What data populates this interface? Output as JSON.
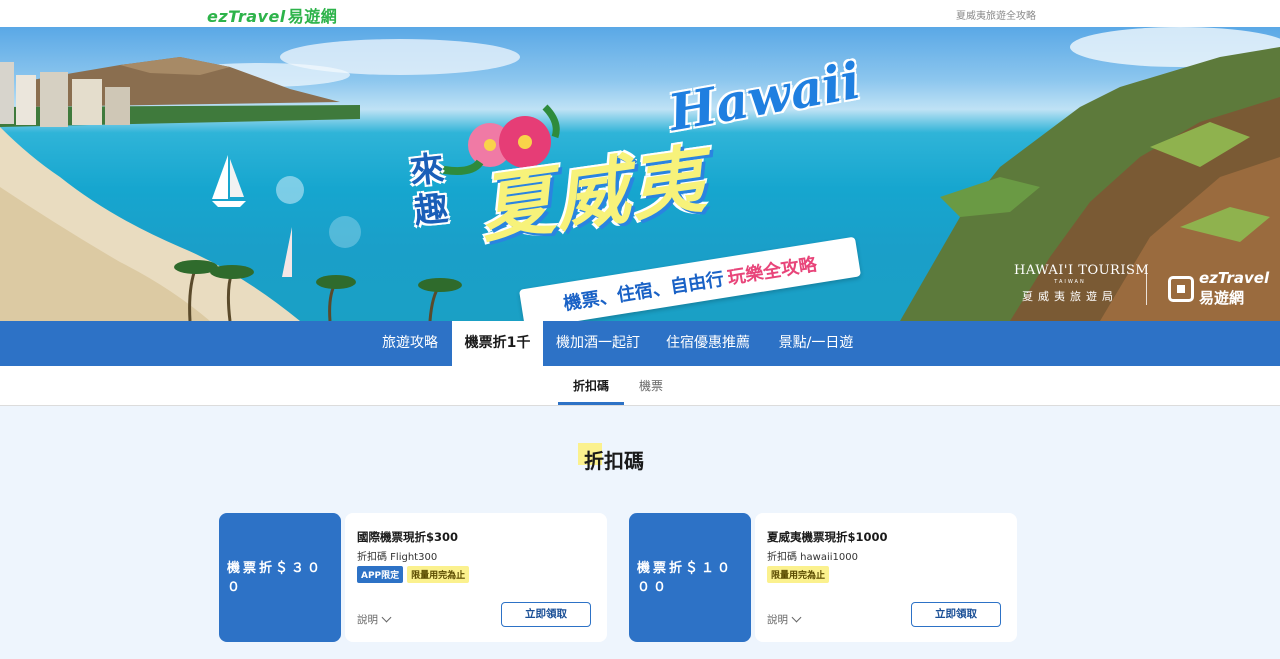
{
  "header": {
    "logo_en": "ezTravel",
    "logo_cn": "易遊網",
    "link": "夏威夷旅遊全攻略"
  },
  "banner": {
    "hawaii": "Hawaii",
    "come": "來趣",
    "main": "夏威夷",
    "ribbon_a": "機票、住宿、自由行",
    "ribbon_b": "玩樂全攻略",
    "tourism_en": "HAWAI'I TOURISM",
    "tourism_sub": "TAIWAN",
    "tourism_cn": "夏威夷旅遊局",
    "ez_en": "ezTravel",
    "ez_cn": "易遊網"
  },
  "main_nav": [
    {
      "label": "旅遊攻略"
    },
    {
      "label": "機票折1千"
    },
    {
      "label": "機加酒一起訂"
    },
    {
      "label": "住宿優惠推薦"
    },
    {
      "label": "景點/一日遊"
    }
  ],
  "sub_nav": [
    {
      "label": "折扣碼"
    },
    {
      "label": "機票"
    }
  ],
  "section": {
    "title": "折扣碼"
  },
  "coupons": [
    {
      "left": "機票折＄３００",
      "title": "國際機票現折$300",
      "code": "折扣碼 Flight300",
      "tags": [
        "APP限定",
        "限量用完為止"
      ],
      "explain": "說明",
      "button": "立即領取"
    },
    {
      "left": "機票折＄１０００",
      "title": "夏威夷機票現折$1000",
      "code": "折扣碼 hawaii1000",
      "tags": [
        "限量用完為止"
      ],
      "explain": "說明",
      "button": "立即領取"
    }
  ],
  "colors": {
    "primary": "#2d72c6",
    "brand_green": "#2db34a",
    "highlight": "#fbf18e",
    "page_bg": "#eef5fd"
  }
}
